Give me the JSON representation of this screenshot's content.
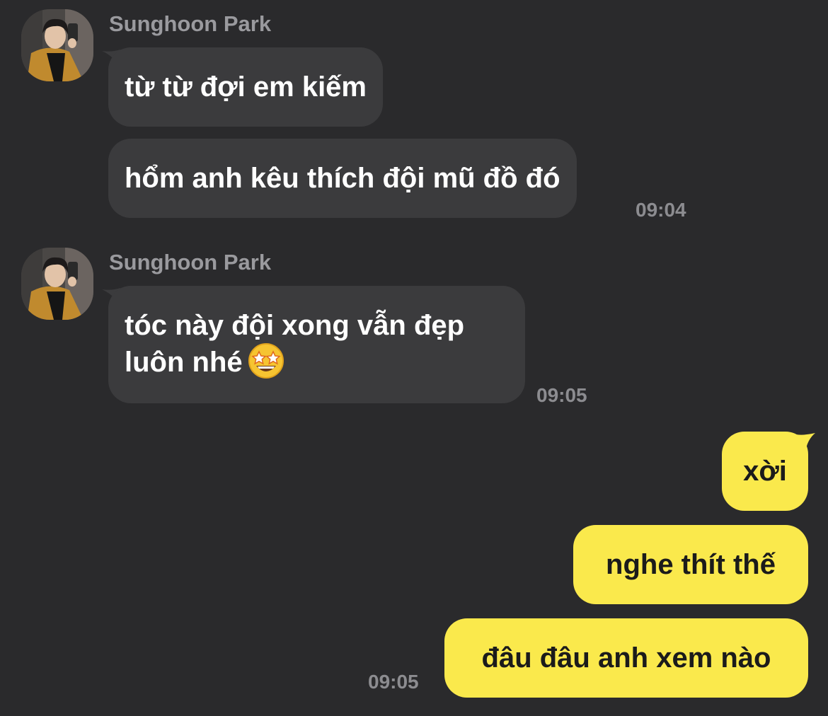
{
  "theme": {
    "background": "#2a2a2c",
    "incoming_bubble": "#3b3b3d",
    "outgoing_bubble": "#fae94c",
    "timestamp_color": "#8c8c90",
    "sender_color": "#9a9a9e"
  },
  "groups": [
    {
      "sender": "Sunghoon Park",
      "messages": [
        "từ từ đợi em kiếm",
        "hổm anh kêu thích đội mũ đồ đó"
      ],
      "time": "09:04"
    },
    {
      "sender": "Sunghoon Park",
      "message_line1": "tóc này đội xong vẫn đẹp",
      "message_line2": "luôn nhé",
      "emoji": "star-struck-emoji",
      "time": "09:05"
    }
  ],
  "outgoing": {
    "messages": [
      "xời",
      "nghe thít thế",
      "đâu đâu anh xem nào"
    ],
    "time": "09:05"
  }
}
